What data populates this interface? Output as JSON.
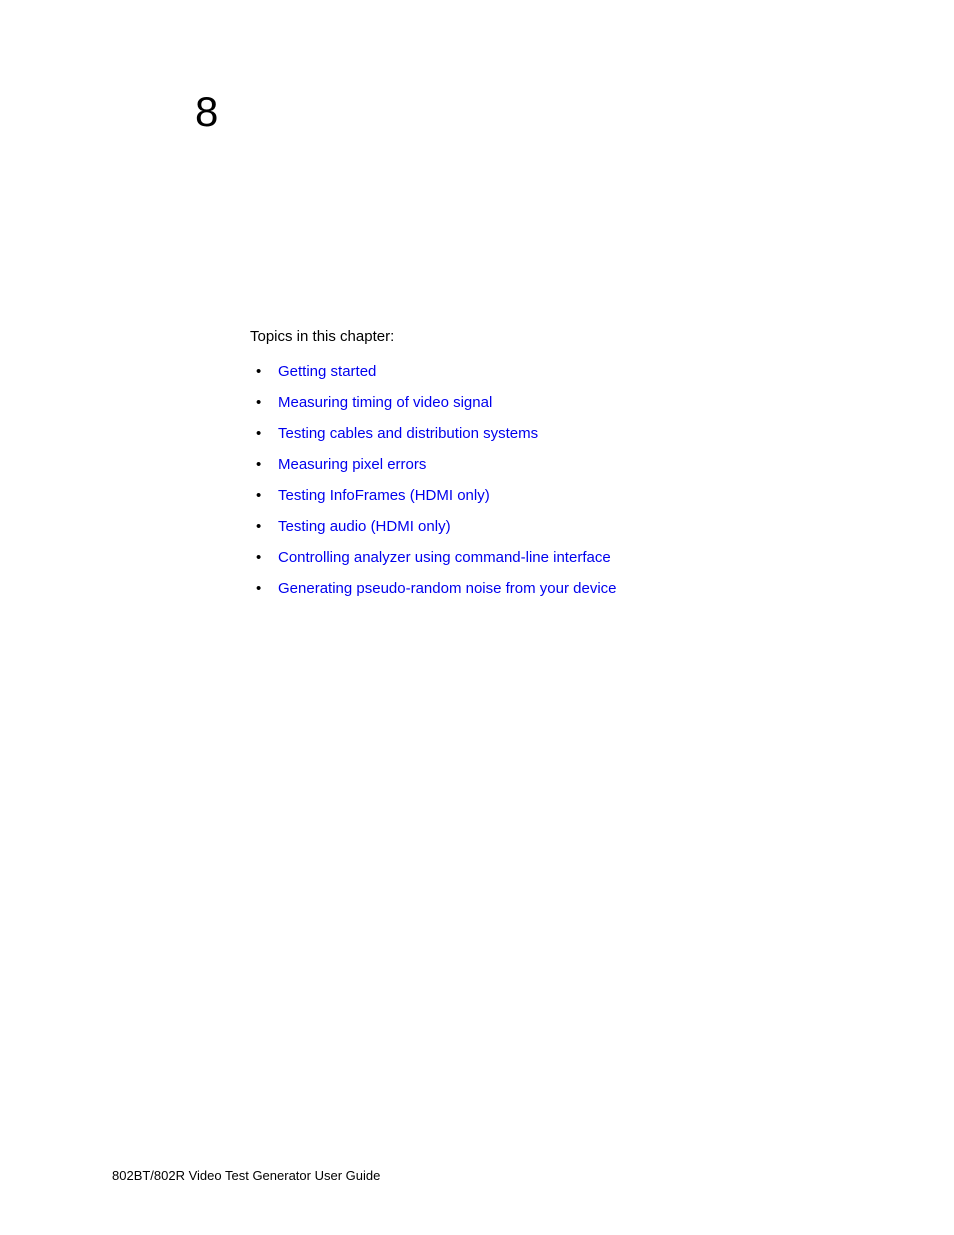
{
  "chapter_number": "8",
  "intro": "Topics in this chapter:",
  "topics": [
    "Getting started",
    "Measuring timing of video signal",
    "Testing cables and distribution systems",
    "Measuring pixel errors",
    "Testing InfoFrames (HDMI only)",
    "Testing audio (HDMI only)",
    "Controlling analyzer using command-line interface",
    "Generating pseudo-random noise from your device"
  ],
  "footer": "802BT/802R Video Test Generator User Guide"
}
